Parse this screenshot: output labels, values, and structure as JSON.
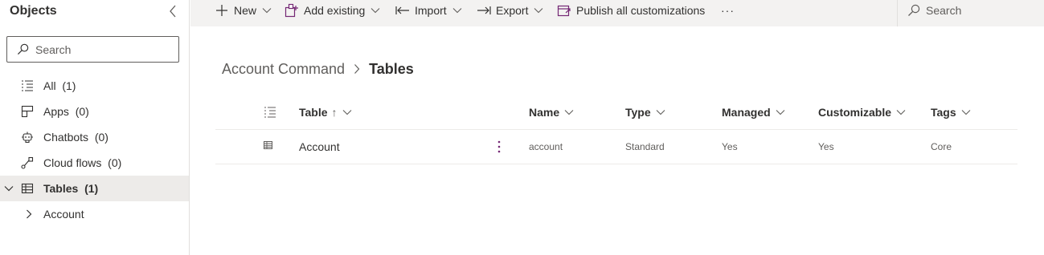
{
  "left_panel": {
    "title": "Objects",
    "search_placeholder": "Search",
    "nav_items": [
      {
        "label": "All",
        "count": "(1)"
      },
      {
        "label": "Apps",
        "count": "(0)"
      },
      {
        "label": "Chatbots",
        "count": "(0)"
      },
      {
        "label": "Cloud flows",
        "count": "(0)"
      },
      {
        "label": "Tables",
        "count": "(1)"
      },
      {
        "label": "Account",
        "count": ""
      }
    ]
  },
  "command_bar": {
    "new": "New",
    "add_existing": "Add existing",
    "import": "Import",
    "export": "Export",
    "publish": "Publish all customizations",
    "more": "···",
    "search": "Search"
  },
  "breadcrumb": {
    "parent": "Account Command",
    "current": "Tables"
  },
  "grid": {
    "columns": {
      "table": "Table",
      "table_sort": "↑",
      "name": "Name",
      "type": "Type",
      "managed": "Managed",
      "customizable": "Customizable",
      "tags": "Tags"
    },
    "rows": [
      {
        "table": "Account",
        "name": "account",
        "type": "Standard",
        "managed": "Yes",
        "customizable": "Yes",
        "tags": "Core"
      }
    ]
  },
  "colors": {
    "text": "#323130",
    "secondary_text": "#605e5c",
    "accent": "#742774",
    "command_bar_bg": "#f3f2f1",
    "selected_bg": "#edebe9"
  }
}
